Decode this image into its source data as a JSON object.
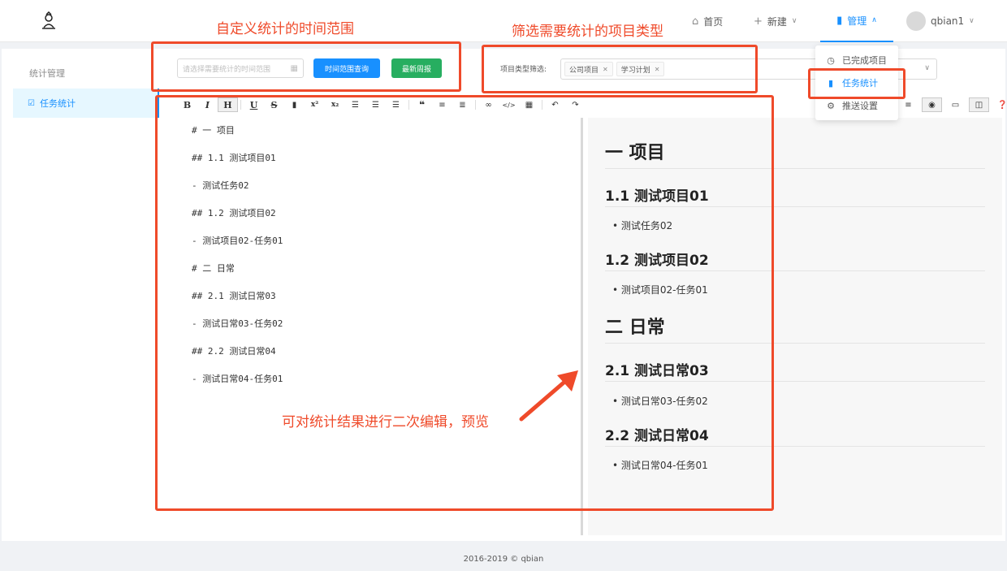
{
  "header": {
    "nav": [
      {
        "label": "首页",
        "icon": "home-icon"
      },
      {
        "label": "新建",
        "icon": "plus-icon"
      },
      {
        "label": "管理",
        "icon": "bar-chart-icon"
      }
    ],
    "user": "qbian1"
  },
  "dropdown": {
    "items": [
      {
        "label": "已完成项目",
        "icon": "clock-icon"
      },
      {
        "label": "任务统计",
        "icon": "bar-chart-icon"
      },
      {
        "label": "推送设置",
        "icon": "gear-icon"
      }
    ]
  },
  "sidebar": {
    "title": "统计管理",
    "items": [
      {
        "label": "任务统计",
        "icon": "checkbox-icon"
      }
    ]
  },
  "filters": {
    "date_placeholder": "请选择需要统计的时间范围",
    "query_button": "时间范围查询",
    "weekly_button": "最新周报",
    "type_label": "项目类型筛选:",
    "tags": [
      "公司项目",
      "学习计划"
    ]
  },
  "editor": {
    "markdown": [
      "# 一 项目",
      "## 1.1 测试项目01",
      "- 测试任务02",
      "## 1.2 测试项目02",
      "- 测试项目02-任务01",
      "# 二 日常",
      "## 2.1 测试日常03",
      "- 测试日常03-任务02",
      "## 2.2 测试日常04",
      "- 测试日常04-任务01"
    ]
  },
  "preview": {
    "h1_a": "一 项目",
    "h2_a": "1.1 测试项目01",
    "li_a": "测试任务02",
    "h2_b": "1.2 测试项目02",
    "li_b": "测试项目02-任务01",
    "h1_b": "二 日常",
    "h2_c": "2.1 测试日常03",
    "li_c": "测试日常03-任务02",
    "h2_d": "2.2 测试日常04",
    "li_d": "测试日常04-任务01"
  },
  "annotations": {
    "time_range": "自定义统计的时间范围",
    "type_filter": "筛选需要统计的项目类型",
    "edit_preview": "可对统计结果进行二次编辑，预览"
  },
  "footer": "2016-2019 © qbian",
  "colors": {
    "primary": "#1890ff",
    "success": "#27ae60",
    "annotation": "#ef4a2a"
  }
}
